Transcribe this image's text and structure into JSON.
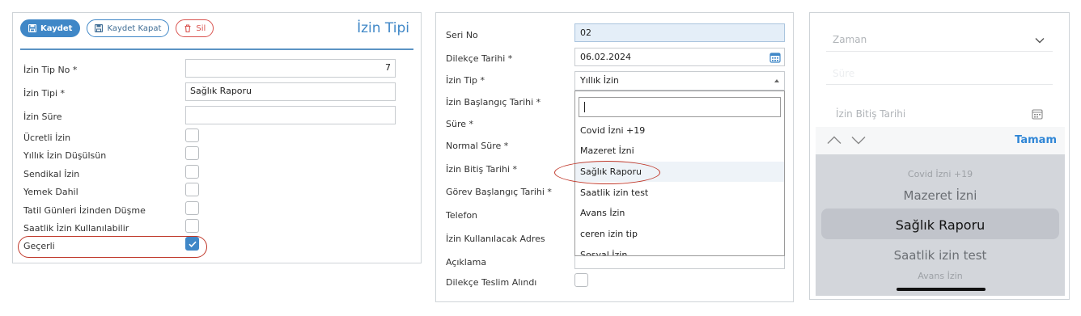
{
  "panel1": {
    "buttons": {
      "save": "Kaydet",
      "save_close": "Kaydet Kapat",
      "delete": "Sil"
    },
    "title": "İzin Tipi",
    "fields": {
      "no_label": "İzin Tip No *",
      "no_value": "7",
      "type_label": "İzin Tipi *",
      "type_value": "Sağlık Raporu",
      "duration_label": "İzin Süre",
      "duration_value": ""
    },
    "checkboxes": [
      {
        "label": "Ücretli İzin",
        "checked": false
      },
      {
        "label": "Yıllık İzin Düşülsün",
        "checked": false
      },
      {
        "label": "Sendikal İzin",
        "checked": false
      },
      {
        "label": "Yemek Dahil",
        "checked": false
      },
      {
        "label": "Tatil Günleri İzinden Düşme",
        "checked": false
      },
      {
        "label": "Saatlik İzin Kullanılabilir",
        "checked": false
      },
      {
        "label": "Geçerli",
        "checked": true
      }
    ],
    "accent": "#3f87c7",
    "annotation_color": "#c0392b"
  },
  "panel2": {
    "labels": {
      "seri": "Seri No",
      "dilekce_tarihi": "Dilekçe Tarihi *",
      "izin_tip": "İzin Tip *",
      "baslangic": "İzin Başlangıç Tarihi *",
      "sure": "Süre *",
      "normal_sure": "Normal Süre *",
      "bitis": "İzin Bitiş Tarihi *",
      "gorev_baslangic": "Görev Başlangıç Tarihi *",
      "telefon": "Telefon",
      "adres": "İzin Kullanılacak Adres",
      "aciklama": "Açıklama",
      "teslim": "Dilekçe Teslim Alındı"
    },
    "values": {
      "seri": "02",
      "dilekce_tarihi": "06.02.2024",
      "izin_tip": "Yıllık İzin"
    },
    "dropdown_options": [
      "Covid İzni +19",
      "Mazeret İzni",
      "Sağlık Raporu",
      "Saatlik izin test",
      "Avans İzin",
      "ceren izin tip",
      "Sosyal İzin"
    ],
    "highlighted_option": "Sağlık Raporu"
  },
  "panel3": {
    "fields": {
      "zaman": "Zaman",
      "sure": "Süre",
      "bitis": "İzin Bitiş Tarihi"
    },
    "done": "Tamam",
    "wheel": [
      "Covid İzni +19",
      "Mazeret İzni",
      "Sağlık Raporu",
      "Saatlik izin test",
      "Avans İzin"
    ],
    "selected": "Sağlık Raporu",
    "link_color": "#2f86d6"
  }
}
